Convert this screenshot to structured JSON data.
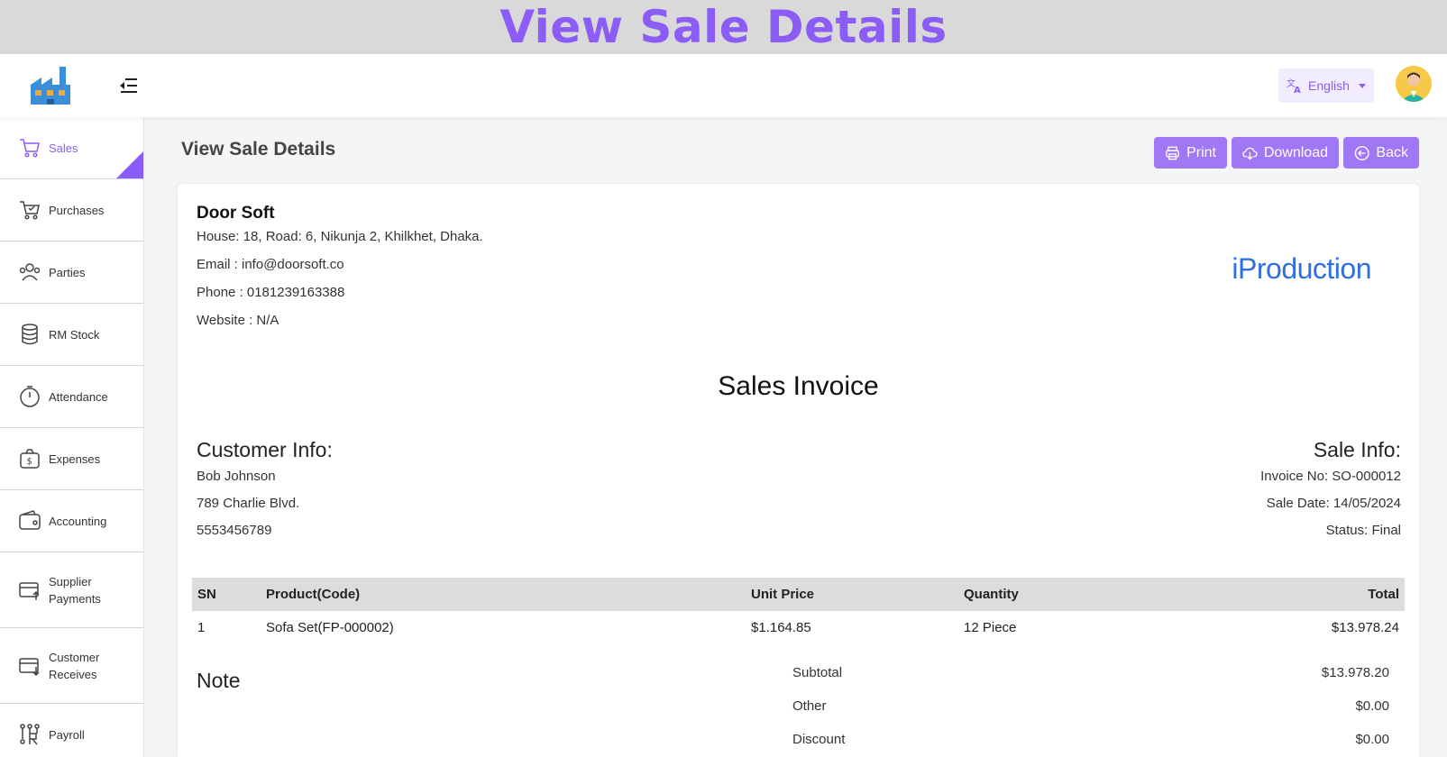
{
  "banner": {
    "title": "View Sale Details"
  },
  "header": {
    "language": {
      "label": "English",
      "icon": "translate-icon"
    },
    "avatar_icon": "user-avatar",
    "menu_icon": "menu-collapse-icon"
  },
  "sidebar": {
    "items": [
      {
        "label": "Sales",
        "icon": "cart-icon",
        "active": true
      },
      {
        "label": "Purchases",
        "icon": "cart-check-icon",
        "active": false
      },
      {
        "label": "Parties",
        "icon": "users-icon",
        "active": false
      },
      {
        "label": "RM Stock",
        "icon": "database-icon",
        "active": false
      },
      {
        "label": "Attendance",
        "icon": "stopwatch-icon",
        "active": false
      },
      {
        "label": "Expenses",
        "icon": "money-bag-icon",
        "active": false
      },
      {
        "label": "Accounting",
        "icon": "wallet-icon",
        "active": false
      },
      {
        "label": "Supplier Payments",
        "label_line1": "Supplier",
        "label_line2": "Payments",
        "icon": "card-out-icon",
        "active": false
      },
      {
        "label": "Customer Receives",
        "label_line1": "Customer",
        "label_line2": "Receives",
        "icon": "card-in-icon",
        "active": false
      },
      {
        "label": "Payroll",
        "icon": "payroll-icon",
        "active": false
      }
    ]
  },
  "page": {
    "title": "View Sale Details",
    "buttons": {
      "print": "Print",
      "download": "Download",
      "back": "Back"
    }
  },
  "company": {
    "name": "Door Soft",
    "address": "House: 18, Road: 6, Nikunja 2, Khilkhet, Dhaka.",
    "email": "Email : info@doorsoft.co",
    "phone": "Phone : 0181239163388",
    "website": "Website : N/A",
    "brand": "iProduction"
  },
  "invoice": {
    "title": "Sales Invoice",
    "customer": {
      "heading": "Customer Info:",
      "name": "Bob Johnson",
      "address": "789 Charlie Blvd.",
      "phone": "5553456789"
    },
    "sale": {
      "heading": "Sale Info:",
      "invoice_no": "Invoice No: SO-000012",
      "sale_date": "Sale Date: 14/05/2024",
      "status": "Status: Final"
    },
    "table": {
      "headers": [
        "SN",
        "Product(Code)",
        "Unit Price",
        "Quantity",
        "Total"
      ],
      "rows": [
        [
          "1",
          "Sofa Set(FP-000002)",
          "$1.164.85",
          "12 Piece",
          "$13.978.24"
        ]
      ]
    },
    "note_label": "Note",
    "totals": [
      {
        "label": "Subtotal",
        "value": "$13.978.20"
      },
      {
        "label": "Other",
        "value": "$0.00"
      },
      {
        "label": "Discount",
        "value": "$0.00"
      }
    ]
  },
  "colors": {
    "accent": "#8b5cf6",
    "button": "#a078f5",
    "brand": "#2f6fe0"
  }
}
